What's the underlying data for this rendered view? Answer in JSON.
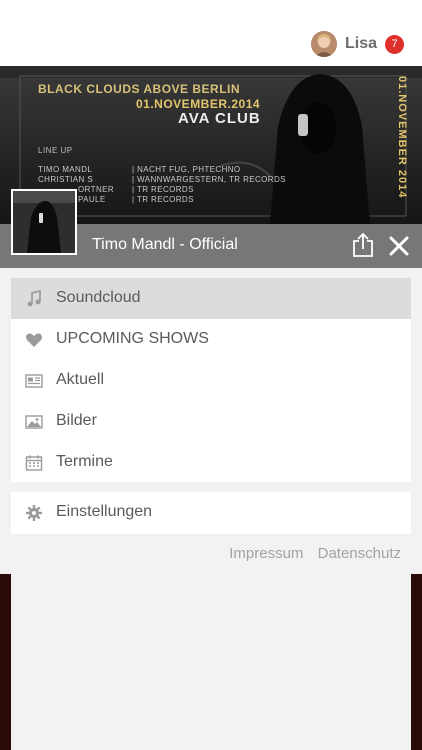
{
  "header": {
    "username": "Lisa",
    "notification_count": "7"
  },
  "banner": {
    "title": "BLACK CLOUDS ABOVE BERLIN",
    "date": "01.NOVEMBER.2014",
    "club": "AVA CLUB",
    "lineup_label": "LINE UP",
    "lineup": [
      {
        "name": "TIMO MANDL",
        "label": "| NACHT FUG, PHTECHNO"
      },
      {
        "name": "CHRISTIAN S",
        "label": "| WANNWARGESTERN, TR RECORDS"
      },
      {
        "name": "ORTNER",
        "label": "| TR RECORDS"
      },
      {
        "name": "PAULE",
        "label": "| TR RECORDS"
      }
    ],
    "vertical_date": "01.NOVEMBER 2014"
  },
  "profile": {
    "title": "Timo Mandl - Official"
  },
  "menu": {
    "items": [
      {
        "label": "Soundcloud",
        "icon": "music-note-icon"
      },
      {
        "label": "UPCOMING SHOWS",
        "icon": "heart-icon"
      },
      {
        "label": "Aktuell",
        "icon": "newspaper-icon"
      },
      {
        "label": "Bilder",
        "icon": "image-icon"
      },
      {
        "label": "Termine",
        "icon": "calendar-icon"
      }
    ],
    "settings": {
      "label": "Einstellungen",
      "icon": "gear-icon"
    }
  },
  "footer_links": {
    "impressum": "Impressum",
    "datenschutz": "Datenschutz"
  },
  "colors": {
    "strip": "#777777",
    "badge": "#e0302b",
    "active_item": "#dcdcdc",
    "banner_gold": "#e4c66c"
  }
}
